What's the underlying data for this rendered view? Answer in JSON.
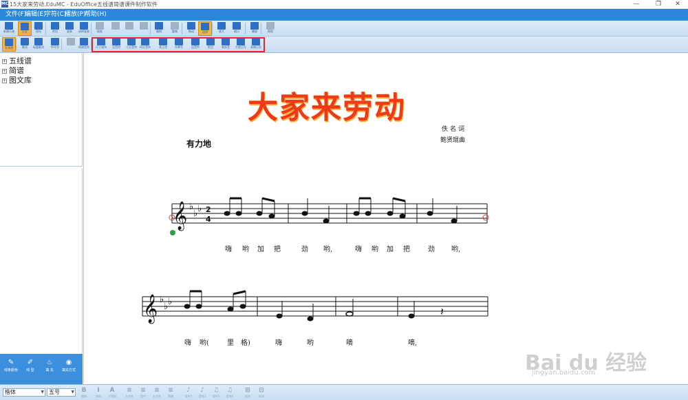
{
  "window": {
    "title": "15大家来劳动.EduMC - EduOffice五线谱简谱课件制作软件",
    "icon_text": "MC",
    "minimize": "—",
    "maximize": "❐",
    "close": "✕"
  },
  "menu": [
    {
      "label": "文件(F)"
    },
    {
      "label": "编辑(E)"
    },
    {
      "label": "字符(C)"
    },
    {
      "label": "播放(P)"
    },
    {
      "label": "帮助(H)"
    }
  ],
  "toolbar1": [
    {
      "label": "新建乐谱",
      "icon": "new-file-icon",
      "color": "#2e6fc4"
    },
    {
      "label": "打开",
      "icon": "open-folder-icon",
      "color": "#2e6fc4",
      "active": true
    },
    {
      "label": "保存",
      "icon": "save-icon",
      "color": "#2e6fc4"
    },
    {
      "label": "剪切",
      "icon": "cut-icon",
      "color": "#2e6fc4"
    },
    {
      "label": "复制",
      "icon": "copy-icon",
      "color": "#2e6fc4"
    },
    {
      "label": "选择复制",
      "icon": "select-copy-icon",
      "color": "#2e6fc4"
    },
    {
      "label": "粘贴",
      "icon": "paste-icon",
      "color": "#9fb1c4"
    },
    {
      "label": "",
      "icon": "note-tool-1-icon",
      "color": "#9fb1c4"
    },
    {
      "label": "",
      "icon": "note-tool-2-icon",
      "color": "#9fb1c4"
    },
    {
      "label": "",
      "icon": "note-tool-3-icon",
      "color": "#9fb1c4"
    },
    {
      "label": "撤销",
      "icon": "undo-icon",
      "color": "#2e6fc4"
    },
    {
      "label": "重做",
      "icon": "redo-icon",
      "color": "#9fb1c4"
    },
    {
      "label": "拖动",
      "icon": "hand-icon",
      "color": "#2e6fc4"
    },
    {
      "label": "选择",
      "icon": "pointer-icon",
      "color": "#2e6fc4",
      "active": true
    },
    {
      "label": "放大",
      "icon": "zoom-in-icon",
      "color": "#2e6fc4"
    },
    {
      "label": "缩小",
      "icon": "zoom-out-icon",
      "color": "#2e6fc4"
    },
    {
      "label": "播放",
      "icon": "play-icon",
      "color": "#2e6fc4"
    },
    {
      "label": "帮助",
      "icon": "help-icon",
      "color": "#9fb1c4"
    }
  ],
  "toolbar2": [
    {
      "label": "五线谱",
      "icon": "staff-mode-icon",
      "color": "#2e6fc4",
      "active": true
    },
    {
      "label": "歌词",
      "icon": "lyrics-icon",
      "color": "#2e6fc4"
    },
    {
      "label": "标题歌词",
      "icon": "text-cursor-icon",
      "color": "#2e6fc4"
    },
    {
      "label": "符号字",
      "icon": "symbol-text-icon",
      "color": "#2e6fc4"
    },
    {
      "label": "",
      "icon": "chord-icon",
      "color": "#9fb1c4"
    },
    {
      "label": "简谱音符",
      "icon": "numbered-notation-icon",
      "color": "#2e6fc4"
    },
    {
      "label": "尺寸调节",
      "icon": "ruler-icon",
      "color": "#2e6fc4"
    },
    {
      "label": "全音符",
      "icon": "whole-note-icon",
      "color": "#2e6fc4"
    },
    {
      "label": "二分音符",
      "icon": "half-note-icon",
      "color": "#2e6fc4"
    },
    {
      "label": "四分音符",
      "icon": "quarter-note-icon",
      "color": "#2e6fc4"
    },
    {
      "label": "休止符",
      "icon": "rest-icon",
      "color": "#2e6fc4"
    },
    {
      "label": "升降号",
      "icon": "accidental-icon",
      "color": "#2e6fc4"
    },
    {
      "label": "连音符",
      "icon": "tuplet-icon",
      "color": "#2e6fc4"
    },
    {
      "label": "附点",
      "icon": "dot-icon",
      "color": "#2e6fc4"
    },
    {
      "label": "装饰音",
      "icon": "grace-note-icon",
      "color": "#2e6fc4"
    },
    {
      "label": "力度记号",
      "icon": "dynamics-icon",
      "color": "#2e6fc4"
    },
    {
      "label": "表情记号",
      "icon": "expression-icon",
      "color": "#2e6fc4"
    },
    {
      "label": "演奏记号",
      "icon": "articulation-icon",
      "color": "#2e6fc4"
    }
  ],
  "tree": [
    {
      "label": "五线谱",
      "expander": "+"
    },
    {
      "label": "简谱",
      "expander": "+"
    },
    {
      "label": "图文库",
      "expander": "+"
    }
  ],
  "left_tools": [
    {
      "label": "线条颜色",
      "icon": "line-color-icon",
      "glyph": "✎"
    },
    {
      "label": "线 型",
      "icon": "line-style-icon",
      "glyph": "✐"
    },
    {
      "label": "填 充",
      "icon": "fill-icon",
      "glyph": "♨"
    },
    {
      "label": "填充方式",
      "icon": "fill-mode-icon",
      "glyph": "◉"
    }
  ],
  "score": {
    "title": "大家来劳动",
    "tempo": "有力地",
    "lyricist": "佚名词",
    "composer": "鲍贤琨曲",
    "key_signature": "E♭ major",
    "time_signature": "2/4",
    "line1_lyrics": [
      "嗨",
      "哟",
      "加",
      "把",
      "劲",
      "哟,",
      "嗨",
      "哟",
      "加",
      "把",
      "劲",
      "哟,"
    ],
    "line2_lyrics": [
      "嗨",
      "哟(",
      "里",
      "格)",
      "嗨",
      "哟",
      "嘀",
      "嘀,"
    ]
  },
  "formatbar": {
    "font": "楷体",
    "size": "五号",
    "buttons": [
      {
        "label": "粗体",
        "glyph": "B"
      },
      {
        "label": "斜体",
        "glyph": "I"
      },
      {
        "label": "下划线",
        "glyph": "A"
      },
      {
        "label": "左对齐",
        "glyph": "≡"
      },
      {
        "label": "居中",
        "glyph": "≡"
      },
      {
        "label": "右对齐",
        "glyph": "≡"
      },
      {
        "label": "两端",
        "glyph": "≡"
      },
      {
        "label": "音符1",
        "glyph": "♪"
      },
      {
        "label": "音符2",
        "glyph": "♪"
      },
      {
        "label": "音符3",
        "glyph": "♫"
      },
      {
        "label": "音符4",
        "glyph": "♫"
      },
      {
        "label": "组合",
        "glyph": "⊞"
      },
      {
        "label": "取消",
        "glyph": "⊟"
      }
    ]
  },
  "watermark": {
    "main": "Bai du 经验",
    "sub": "jingyan.baidu.com"
  },
  "colors": {
    "menubar": "#2b87d8",
    "highlight": "#e8262a",
    "title_red": "#ef3a1a",
    "active_button": "#f2b34a"
  }
}
